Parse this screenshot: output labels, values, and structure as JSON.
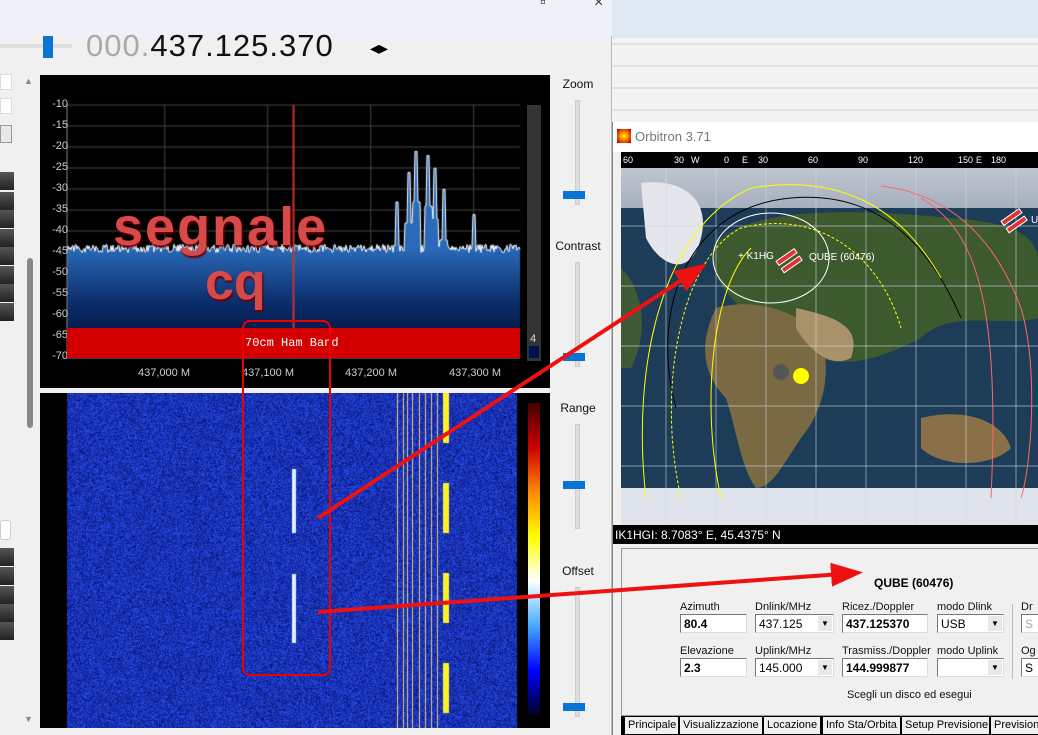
{
  "sdr": {
    "frequency_dim": "000.",
    "frequency_main": "437.125.370",
    "frequency_arrows": "◂▸",
    "spectrum": {
      "y_ticks": [
        "-10",
        "-15",
        "-20",
        "-25",
        "-30",
        "-35",
        "-40",
        "-45",
        "-50",
        "-55",
        "-60",
        "-65",
        "-70"
      ],
      "x_ticks": [
        "437,000 M",
        "437,100 M",
        "437,200 M",
        "437,300 M"
      ],
      "band_label": "70cm Ham Band",
      "overlay_text_1": "segnale",
      "overlay_text_2": "cq",
      "side_value": "4",
      "tuned_line_color": "#c83232",
      "band_color": "#d40000",
      "noise_floor_db": -44,
      "peaks": [
        {
          "freq_mhz": 437.226,
          "db": -33
        },
        {
          "freq_mhz": 437.237,
          "db": -26
        },
        {
          "freq_mhz": 437.244,
          "db": -21
        },
        {
          "freq_mhz": 437.256,
          "db": -22
        },
        {
          "freq_mhz": 437.262,
          "db": -25
        },
        {
          "freq_mhz": 437.271,
          "db": -30
        },
        {
          "freq_mhz": 437.3,
          "db": -36
        }
      ]
    },
    "sliders": [
      {
        "label": "Zoom",
        "level": 0.1
      },
      {
        "label": "Contrast",
        "level": 0.1
      },
      {
        "label": "Range",
        "level": 0.42
      },
      {
        "label": "Offset",
        "level": 0.08
      }
    ]
  },
  "orbitron": {
    "title": "Orbitron 3.71",
    "map_lon_labels": [
      "60",
      "30",
      "W",
      "0",
      "E",
      "30",
      "60",
      "90",
      "120",
      "150",
      "E",
      "180"
    ],
    "satellite_label": "QUBE (60476)",
    "station_label": "+ K1HG",
    "other_sat_label": "U",
    "status": "IK1HGI: 8.7083° E, 45.4375° N",
    "panel": {
      "sat_name": "QUBE (60476)",
      "azimuth_label": "Azimuth",
      "azimuth": "80.4",
      "elevation_label": "Elevazione",
      "elevation": "2.3",
      "dnlink_label": "Dnlink/MHz",
      "dnlink": "437.125",
      "uplink_label": "Uplink/MHz",
      "uplink": "145.000",
      "rx_label": "Ricez./Doppler",
      "rx": "437.125370",
      "tx_label": "Trasmiss./Doppler",
      "tx": "144.999877",
      "mode_dl_label": "modo Dlink",
      "mode_dl": "USB",
      "mode_ul_label": "modo Uplink",
      "mode_ul": "",
      "cut_label_1": "Dr",
      "cut_value_1": "S",
      "cut_label_2": "Og",
      "cut_value_2": "S",
      "hint": "Scegli un disco ed esegui"
    },
    "tabs": [
      "Principale",
      "Visualizzazione",
      "Locazione",
      "Info Sta/Orbita",
      "Setup Previsione",
      "Previsione"
    ]
  },
  "annotation_color": "#ee1111"
}
